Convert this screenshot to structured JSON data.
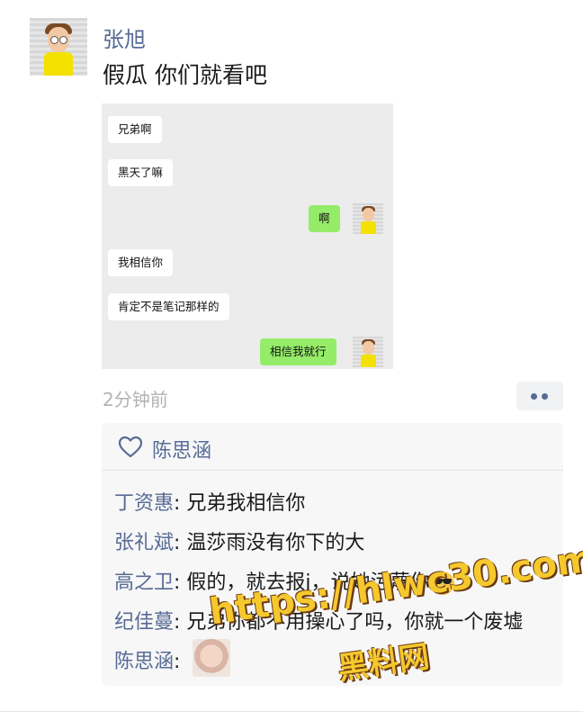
{
  "post": {
    "author": "张旭",
    "text": "假瓜 你们就看吧",
    "time": "2分钟前"
  },
  "screenshot_messages": [
    {
      "side": "left",
      "text": "兄弟啊"
    },
    {
      "side": "left",
      "text": "黑天了嘛"
    },
    {
      "side": "right",
      "text": "啊"
    },
    {
      "side": "left",
      "text": "我相信你"
    },
    {
      "side": "left",
      "text": "肯定不是笔记那样的"
    },
    {
      "side": "right",
      "text": "相信我就行"
    }
  ],
  "likes": {
    "names": "陈思涵"
  },
  "comments": [
    {
      "name": "丁资惠",
      "sep": ": ",
      "text": "兄弟我相信你"
    },
    {
      "name": "张礼斌",
      "sep": ": ",
      "text": "温莎雨没有你下的大"
    },
    {
      "name": "高之卫",
      "sep": ": ",
      "text": "假的，就去报j，说她污蔑你"
    },
    {
      "name": "纪佳蔓",
      "sep": ": ",
      "text": "兄弟你都不用操心了吗，你就一个废墟"
    },
    {
      "name": "陈思涵",
      "sep": ": ",
      "text": ""
    }
  ],
  "watermark": {
    "line1": "https://hlwc30.com",
    "line2": "黑料网"
  },
  "icons": [
    "heart-icon",
    "more-dots-icon",
    "sunglasses-emoji-icon"
  ],
  "colors": {
    "name_blue": "#576b95",
    "bubble_green": "#95ec69",
    "panel_bg": "#f7f7f7"
  }
}
